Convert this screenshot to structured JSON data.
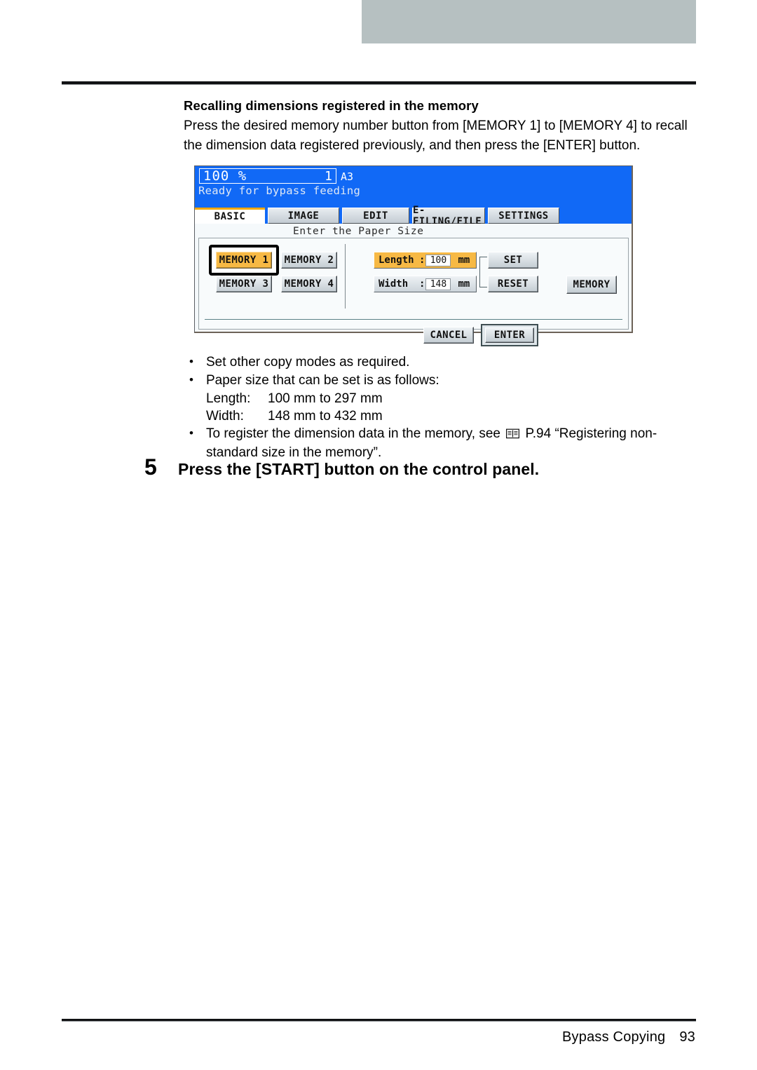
{
  "page": {
    "footer_section": "Bypass Copying",
    "footer_page_number": "93"
  },
  "section": {
    "heading": "Recalling dimensions registered in the memory",
    "paragraph": "Press the desired memory number button from [MEMORY 1] to [MEMORY 4] to recall the dimension data registered previously, and then press the [ENTER] button."
  },
  "lcd": {
    "zoom_ratio": "100",
    "percent_symbol": "%",
    "copy_count": "1",
    "paper_size": "A3",
    "status_message": "Ready for bypass feeding",
    "tabs": [
      {
        "label": "BASIC",
        "active": true
      },
      {
        "label": "IMAGE",
        "active": false
      },
      {
        "label": "EDIT",
        "active": false
      },
      {
        "label": "E-FILING/FILE",
        "active": false
      },
      {
        "label": "SETTINGS",
        "active": false
      }
    ],
    "prompt": "Enter the Paper Size",
    "memory_buttons": [
      {
        "label": "MEMORY 1",
        "selected": true
      },
      {
        "label": "MEMORY 2",
        "selected": false
      },
      {
        "label": "MEMORY 3",
        "selected": false
      },
      {
        "label": "MEMORY 4",
        "selected": false
      }
    ],
    "dimensions": {
      "length": {
        "label": "Length",
        "colon": ":",
        "value": "100",
        "unit": "mm",
        "highlighted": true
      },
      "width": {
        "label": "Width",
        "colon": ":",
        "value": "148",
        "unit": "mm",
        "highlighted": false
      }
    },
    "set_button": "SET",
    "reset_button": "RESET",
    "memory_button": "MEMORY",
    "cancel_button": "CANCEL",
    "enter_button": "ENTER"
  },
  "notes": {
    "bullet1": "Set other copy modes as required.",
    "bullet2": "Paper size that can be set is as follows:",
    "length_label": "Length:",
    "length_range": "100 mm to 297 mm",
    "width_label": "Width:",
    "width_range": "148 mm to 432 mm",
    "bullet3_before_icon": "To register the dimension data in the memory, see",
    "bullet3_after_icon": "P.94 “Registering non-standard size in the memory”."
  },
  "step": {
    "number": "5",
    "text": "Press the [START] button on the control panel."
  },
  "colors": {
    "lcd_blue": "#1169f6",
    "tab_accent_orange": "#f0a800",
    "selected_orange": "#f7b944",
    "top_bar_gray": "#b6c0c1"
  }
}
